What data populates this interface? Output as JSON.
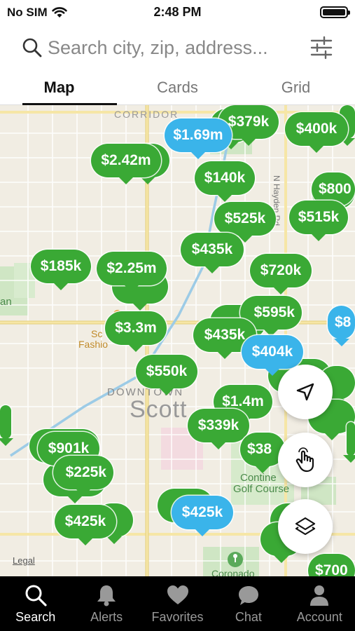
{
  "status_bar": {
    "carrier": "No SIM",
    "time": "2:48 PM"
  },
  "search": {
    "placeholder": "Search city, zip, address..."
  },
  "tabs": [
    {
      "label": "Map",
      "active": true
    },
    {
      "label": "Cards",
      "active": false
    },
    {
      "label": "Grid",
      "active": false
    }
  ],
  "map": {
    "labels": {
      "corridor": "CORRIDOR",
      "downtown": "DOWNTOWN",
      "scott": "Scott",
      "an": "an",
      "fashion1": "Sc",
      "fashion2": "Fashio",
      "hayden": "N Hayden Rd",
      "contin1": "Contine",
      "contin2": "Golf Course",
      "coronado": "Coronado",
      "legal": "Legal"
    },
    "pins": [
      {
        "price": "$379k",
        "color": "green"
      },
      {
        "price": "$1.69m",
        "color": "blue"
      },
      {
        "price": "$400k",
        "color": "green"
      },
      {
        "price": "$2.42m",
        "color": "green"
      },
      {
        "price": "$140k",
        "color": "green"
      },
      {
        "price": "$800",
        "color": "green"
      },
      {
        "price": "$525k",
        "color": "green"
      },
      {
        "price": "$515k",
        "color": "green"
      },
      {
        "price": "$435k",
        "color": "green"
      },
      {
        "price": "$185k",
        "color": "green"
      },
      {
        "price": "$2.25m",
        "color": "green"
      },
      {
        "price": "$720k",
        "color": "green"
      },
      {
        "price": "$595k",
        "color": "green"
      },
      {
        "price": "$8",
        "color": "blue"
      },
      {
        "price": "$3.3m",
        "color": "green"
      },
      {
        "price": "$435k",
        "color": "green"
      },
      {
        "price": "$404k",
        "color": "blue"
      },
      {
        "price": "$550k",
        "color": "green"
      },
      {
        "price": "$1.4m",
        "color": "green"
      },
      {
        "price": "$339k",
        "color": "green"
      },
      {
        "price": "$901k",
        "color": "green"
      },
      {
        "price": "$225k",
        "color": "green"
      },
      {
        "price": "$38",
        "color": "green"
      },
      {
        "price": "$425k",
        "color": "green"
      },
      {
        "price": "$425k",
        "color": "blue"
      },
      {
        "price": "$700",
        "color": "green"
      }
    ]
  },
  "colors": {
    "pin_green": "#3aa935",
    "pin_blue": "#3ab4ea",
    "nav_bg": "#000000"
  },
  "fabs": [
    {
      "icon": "location-arrow-icon"
    },
    {
      "icon": "draw-hand-icon"
    },
    {
      "icon": "layers-icon"
    }
  ],
  "bottom_nav": [
    {
      "label": "Search",
      "icon": "search-icon",
      "active": true
    },
    {
      "label": "Alerts",
      "icon": "bell-icon",
      "active": false
    },
    {
      "label": "Favorites",
      "icon": "heart-icon",
      "active": false
    },
    {
      "label": "Chat",
      "icon": "chat-icon",
      "active": false
    },
    {
      "label": "Account",
      "icon": "person-icon",
      "active": false
    }
  ]
}
